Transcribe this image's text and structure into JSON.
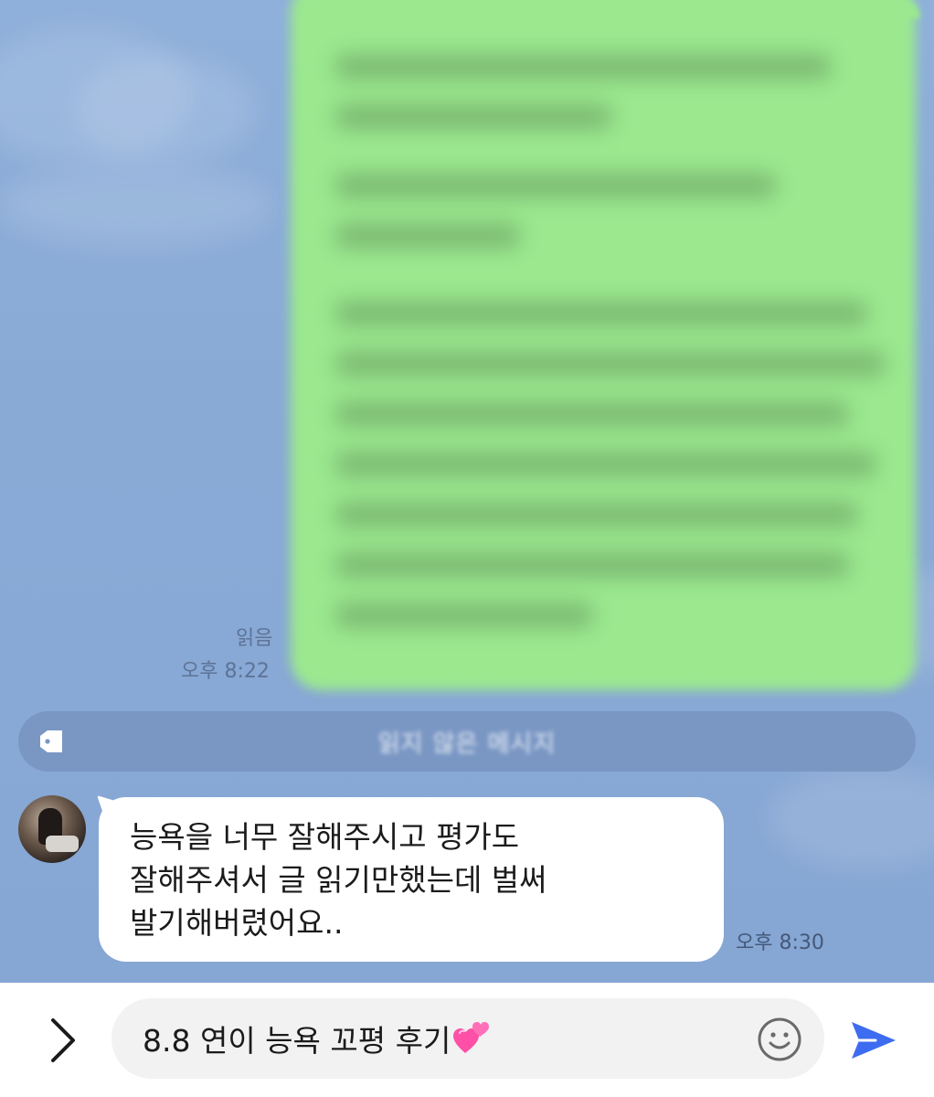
{
  "outgoing_message": {
    "read_status": "읽음",
    "time": "오후 8:22"
  },
  "unread_divider": {
    "label": "읽지 않은 메시지",
    "icon": "tag-icon"
  },
  "incoming_message": {
    "lines": [
      "능욕을 너무 잘해주시고 평가도",
      "잘해주셔서 글 읽기만했는데 벌써",
      "발기해버렸어요.."
    ],
    "time": "오후 8:30"
  },
  "composer": {
    "value": "8.8 연이 능욕 꼬평 후기",
    "value_emoji": "two-hearts-icon",
    "expand_icon": "chevron-right-icon",
    "emoji_icon": "smiley-icon",
    "send_icon": "send-icon"
  },
  "colors": {
    "chat_background": "#8eacd8",
    "outgoing_bubble": "#9be88f",
    "incoming_bubble": "#ffffff",
    "send_accent": "#3d6cf0"
  }
}
